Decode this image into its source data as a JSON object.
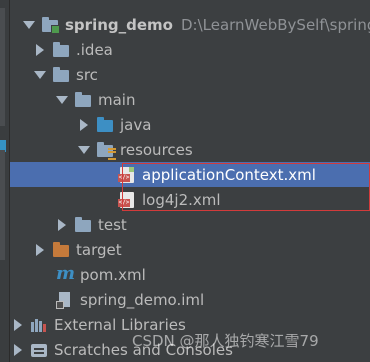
{
  "project_tree": {
    "root": {
      "label": "spring_demo",
      "path": "D:\\LearnWebBySelf\\spring_c"
    },
    "items": [
      {
        "label": ".idea"
      },
      {
        "label": "src"
      },
      {
        "label": "main"
      },
      {
        "label": "java"
      },
      {
        "label": "resources"
      },
      {
        "label": "applicationContext.xml"
      },
      {
        "label": "log4j2.xml"
      },
      {
        "label": "test"
      },
      {
        "label": "target"
      },
      {
        "label": "pom.xml"
      },
      {
        "label": "spring_demo.iml"
      },
      {
        "label": "External Libraries"
      },
      {
        "label": "Scratches and Consoles"
      }
    ],
    "selected_item": "applicationContext.xml"
  },
  "icons": {
    "folder": "folder-icon",
    "source_folder": "source-folder-icon",
    "resources_folder": "resources-folder-icon",
    "xml_file": "xml-file-icon",
    "maven": "maven-pom-icon",
    "iml": "module-file-icon",
    "libraries": "libraries-icon",
    "scratches": "scratches-icon"
  },
  "colors": {
    "background": "#3c3f41",
    "selection": "#4b6eaf",
    "highlight_box": "#d23b3b",
    "source_folder": "#3d8fc4",
    "excluded_folder": "#c57a3b"
  },
  "watermark": {
    "text": "CSDN @那人独钓寒江雪79"
  }
}
